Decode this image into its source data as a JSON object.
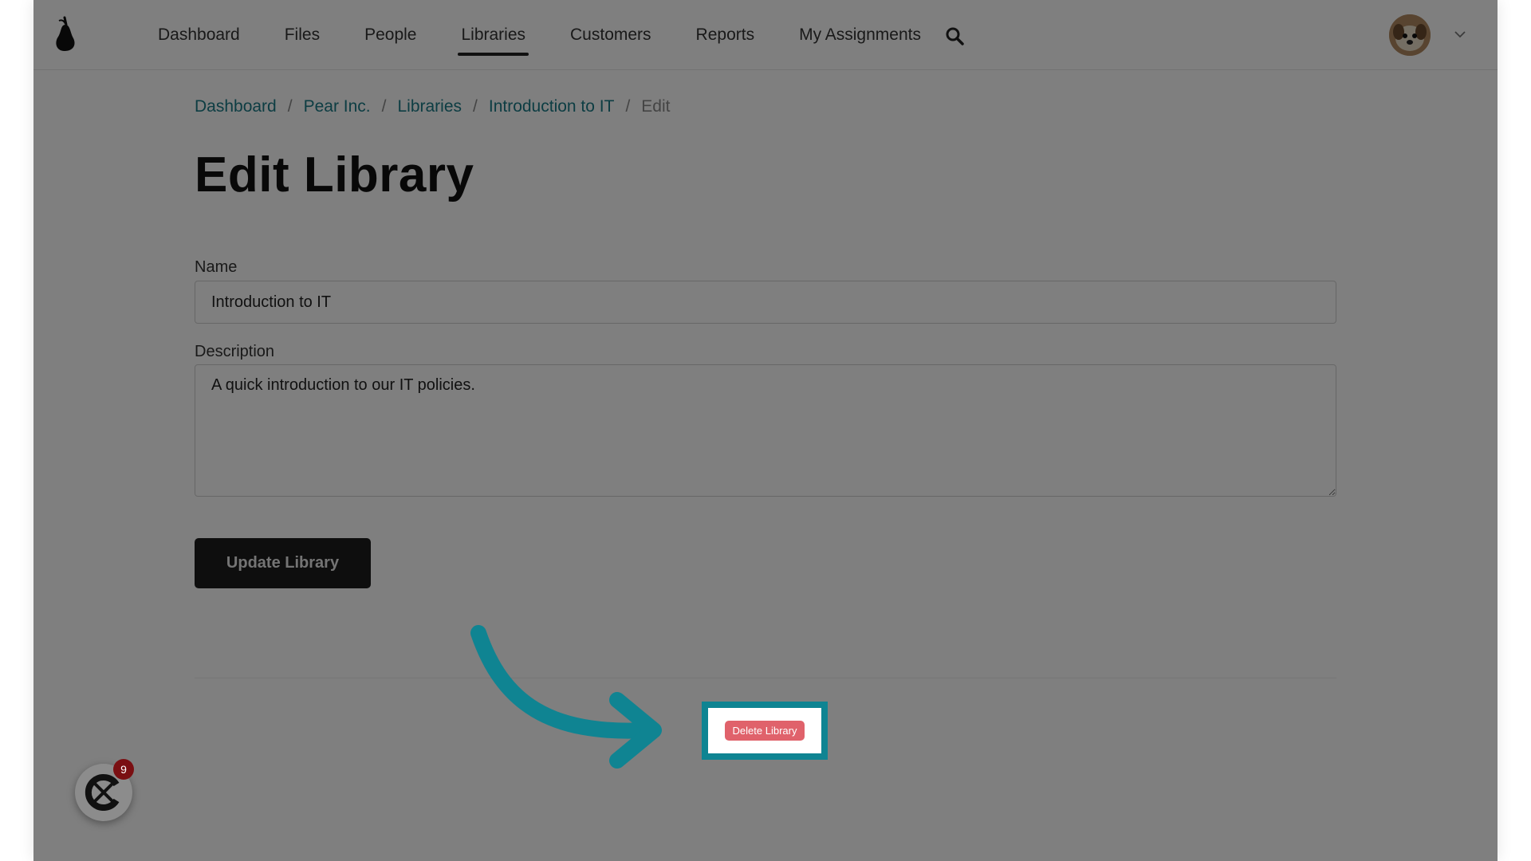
{
  "nav": {
    "items": [
      {
        "label": "Dashboard",
        "active": false
      },
      {
        "label": "Files",
        "active": false
      },
      {
        "label": "People",
        "active": false
      },
      {
        "label": "Libraries",
        "active": true
      },
      {
        "label": "Customers",
        "active": false
      },
      {
        "label": "Reports",
        "active": false
      },
      {
        "label": "My Assignments",
        "active": false
      }
    ],
    "icons": {
      "logo": "pear-logo-icon",
      "search": "search-icon",
      "avatar": "user-avatar",
      "menu": "chevron-down-icon"
    }
  },
  "breadcrumb": {
    "items": [
      "Dashboard",
      "Pear Inc.",
      "Libraries",
      "Introduction to IT"
    ],
    "separator": "/",
    "current": "Edit"
  },
  "page": {
    "title": "Edit Library"
  },
  "form": {
    "name_label": "Name",
    "name_value": "Introduction to IT",
    "description_label": "Description",
    "description_value": "A quick introduction to our IT policies.",
    "submit_label": "Update Library"
  },
  "danger": {
    "delete_label": "Delete Library"
  },
  "widget": {
    "badge_count": "9",
    "icon": "chat-widget-icon"
  },
  "colors": {
    "accent": "#1a7a86",
    "highlight": "#0f8492",
    "delete": "#e0626b",
    "button_dark": "#1c1c1c"
  }
}
